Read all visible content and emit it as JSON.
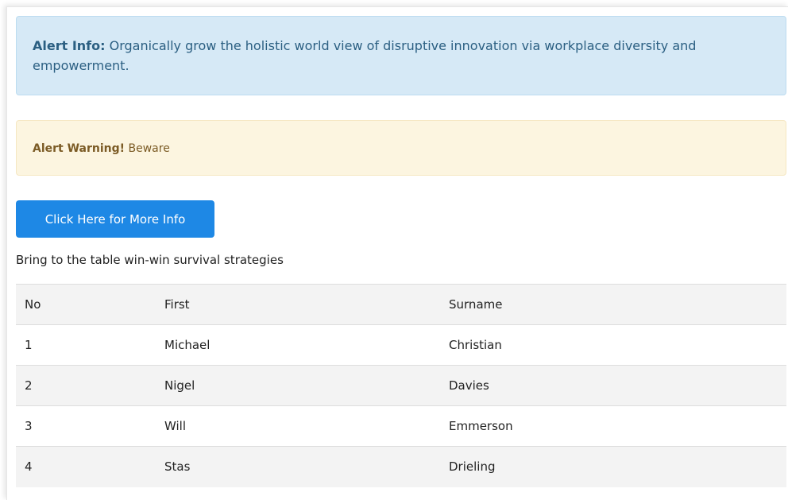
{
  "alerts": {
    "info": {
      "label": "Alert Info:",
      "text": " Organically grow the holistic world view of disruptive innovation via workplace diversity and empowerment."
    },
    "warning": {
      "label": "Alert Warning!",
      "text": " Beware"
    }
  },
  "button": {
    "label": "Click Here for More Info"
  },
  "caption": "Bring to the table win-win survival strategies",
  "table": {
    "headers": [
      "No",
      "First",
      "Surname"
    ],
    "rows": [
      [
        "1",
        "Michael",
        "Christian"
      ],
      [
        "2",
        "Nigel",
        "Davies"
      ],
      [
        "3",
        "Will",
        "Emmerson"
      ],
      [
        "4",
        "Stas",
        "Drieling"
      ]
    ]
  },
  "colors": {
    "info_bg": "#d6e9f6",
    "warning_bg": "#fcf5e0",
    "button_bg": "#1e88e5",
    "stripe_bg": "#f3f3f3"
  }
}
